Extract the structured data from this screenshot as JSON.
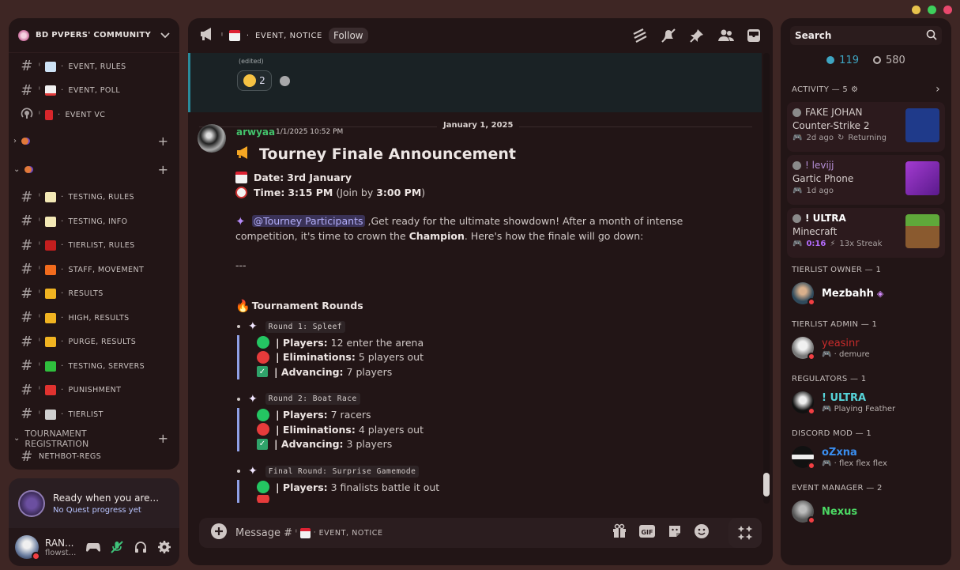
{
  "window": {
    "dot_colors": [
      "#e7c24c",
      "#3ecf5c",
      "#e9486d"
    ]
  },
  "server": {
    "name": "BD PVPERS' COMMUNITY"
  },
  "channels_top": [
    {
      "label": "EVENT, RULES",
      "type": "hash-bell",
      "emoji_color": "#cde2f5"
    },
    {
      "label": "EVENT, POLL",
      "type": "hash-bell",
      "emoji_color": "#f1f1f1"
    },
    {
      "label": "EVENT VC",
      "type": "voice",
      "emoji_color": "#d7262b"
    }
  ],
  "categories": [
    {
      "label": ""
    },
    {
      "label": ""
    }
  ],
  "channels_mid": [
    {
      "label": "TESTING, RULES",
      "emoji_color": "#f3e8b5"
    },
    {
      "label": "TESTING, INFO",
      "emoji_color": "#f3e8b5"
    },
    {
      "label": "TIERLIST, RULES",
      "emoji_color": "#c41e1e"
    },
    {
      "label": "STAFF, MOVEMENT",
      "emoji_color": "#f26b1d"
    },
    {
      "label": "RESULTS",
      "emoji_color": "#f0b321"
    },
    {
      "label": "HIGH, RESULTS",
      "emoji_color": "#f0b321"
    },
    {
      "label": "PURGE, RESULTS",
      "emoji_color": "#f0b321"
    },
    {
      "label": "TESTING, SERVERS",
      "emoji_color": "#2fbf3d"
    },
    {
      "label": "PUNISHMENT",
      "emoji_color": "#e0322f"
    },
    {
      "label": "TIERLIST",
      "emoji_color": "#cfcfcf"
    }
  ],
  "category_registration": {
    "label": "TOURNAMENT REGISTRATION"
  },
  "channel_cut": {
    "label": "NETHBOT-REGS"
  },
  "quest": {
    "title": "Ready when you are...",
    "subtitle": "No Quest progress yet"
  },
  "user": {
    "name": "RAN...",
    "status": "flowst..."
  },
  "header": {
    "channel": "EVENT, NOTICE",
    "follow": "Follow"
  },
  "prev_message": {
    "edited": "(edited)",
    "reaction_count": "2"
  },
  "date_divider": "January 1, 2025",
  "message": {
    "author": "arwyaa",
    "time": "1/1/2025 10:52 PM",
    "title": "Tourney Finale Announcement",
    "date_label": "Date:",
    "date_value": "3rd January",
    "time_label": "Time:",
    "time_value": "3:15 PM",
    "join_prefix": " (Join by ",
    "join_time": "3:00 PM",
    "join_suffix": ")",
    "mention": "@Tourney Participants",
    "intro_1": " ,Get ready for the ultimate showdown! After a month of intense",
    "intro_2a": "competition, it's time to crown the ",
    "intro_2b": "Champion",
    "intro_2c": ". Here's how the finale will go down:",
    "separator": "---",
    "section": "Tournament Rounds",
    "rounds": [
      {
        "name": "Round 1: Spleef",
        "players_label": "| Players:",
        "players": " 12 enter the arena",
        "elim_label": "| Eliminations:",
        "elim": " 5 players out",
        "adv_label": "| Advancing:",
        "adv": " 7 players"
      },
      {
        "name": "Round 2: Boat Race",
        "players_label": "| Players:",
        "players": " 7 racers",
        "elim_label": "| Eliminations:",
        "elim": " 4 players out",
        "adv_label": "| Advancing:",
        "adv": " 3 players"
      },
      {
        "name": "Final Round: Surprise Gamemode",
        "players_label": "| Players:",
        "players": " 3 finalists battle it out"
      }
    ]
  },
  "composer": {
    "prefix": "Message #",
    "channel": "EVENT, NOTICE"
  },
  "right": {
    "search": "Search",
    "online": "119",
    "offline": "580",
    "activity_label": "ACTIVITY — 5",
    "activities": [
      {
        "user": "FAKE JOHAN",
        "user_color": "#d2cac8",
        "game": "Counter-Strike 2",
        "meta1": "2d ago",
        "meta2": "Returning"
      },
      {
        "user": "! levijj",
        "user_color": "#b58fd6",
        "game": "Gartic Phone",
        "meta1": "1d ago",
        "meta2": ""
      },
      {
        "user": "! ULTRA",
        "user_color": "#ffffff",
        "game": "Minecraft",
        "meta1": "0:16",
        "meta2": "13x Streak"
      }
    ],
    "groups": [
      {
        "title": "TIERLIST OWNER — 1",
        "name": "Mezbahh",
        "color": "#ffffff",
        "status": ""
      },
      {
        "title": "TIERLIST ADMIN — 1",
        "name": "yeasinr",
        "color": "#c62b2b",
        "status": "· demure"
      },
      {
        "title": "REGULATORS — 1",
        "name": "! ULTRA",
        "color": "#56d4d9",
        "status": "Playing Feather"
      },
      {
        "title": "DISCORD MOD — 1",
        "name": "oZxna",
        "color": "#3a8ef0",
        "status": "· flex flex flex"
      },
      {
        "title": "EVENT MANAGER — 2",
        "name": "Nexus",
        "color": "#4cd964",
        "status": ""
      }
    ]
  }
}
